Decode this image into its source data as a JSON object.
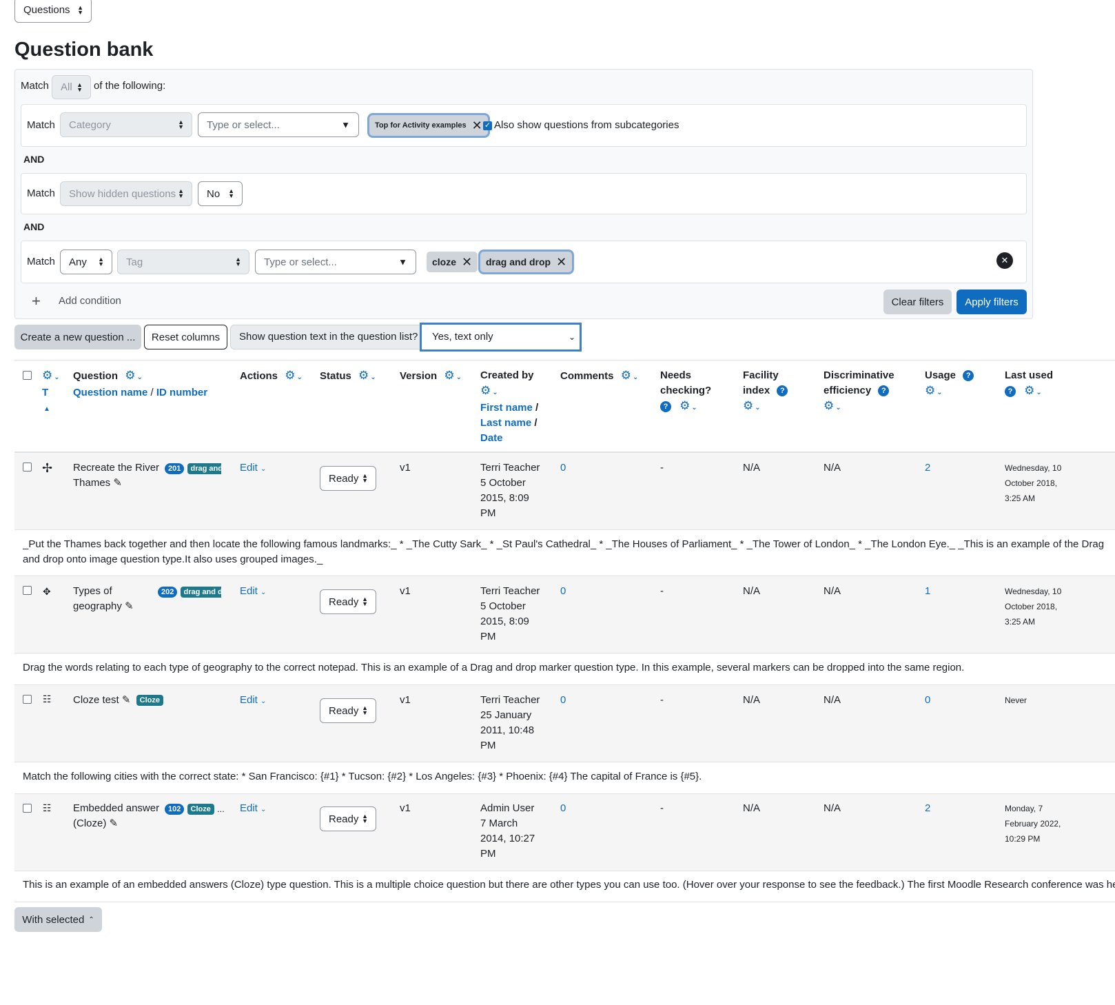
{
  "nav_select": {
    "value": "Questions"
  },
  "page_title": "Question bank",
  "filters": {
    "match_label": "Match",
    "match_all_value": "All",
    "of_following": "of the following:",
    "and_label": "AND",
    "category": {
      "match": "Match",
      "type": "Category",
      "placeholder": "Type or select...",
      "selected": "Top for Activity examples",
      "subcat_label": "Also show questions from subcategories"
    },
    "hidden": {
      "match": "Match",
      "type": "Show hidden questions",
      "value": "No"
    },
    "tag": {
      "match": "Match",
      "mode": "Any",
      "type": "Tag",
      "placeholder": "Type or select...",
      "tags": [
        "cloze",
        "drag and drop"
      ]
    },
    "add_condition": "Add condition",
    "clear": "Clear filters",
    "apply": "Apply filters"
  },
  "toolbar": {
    "create": "Create a new question ...",
    "reset": "Reset columns",
    "show_text_label": "Show question text in the question list?",
    "show_text_value": "Yes, text only"
  },
  "columns": {
    "t": "T",
    "question": "Question",
    "question_name": "Question name",
    "slash": "/",
    "id_number": "ID number",
    "actions": "Actions",
    "status": "Status",
    "version": "Version",
    "created_by": "Created by",
    "first_name": "First name",
    "last_name": "Last name",
    "date": "Date",
    "comments": "Comments",
    "needs_checking_1": "Needs",
    "needs_checking_2": "checking?",
    "facility_1": "Facility",
    "facility_2": "index",
    "discrim_1": "Discriminative",
    "discrim_2": "efficiency",
    "usage": "Usage",
    "last_used": "Last used"
  },
  "rows": [
    {
      "name_1": "Recreate the River",
      "name_2": "Thames",
      "id_badge": "201",
      "type_badge": "drag and",
      "action": "Edit",
      "status": "Ready",
      "version": "v1",
      "created_1": "Terri Teacher",
      "created_2": "5 October",
      "created_3": "2015, 8:09",
      "created_4": "PM",
      "comments": "0",
      "needs": "-",
      "facility": "N/A",
      "discrim": "N/A",
      "usage": "2",
      "last_1": "Wednesday, 10",
      "last_2": "October 2018,",
      "last_3": "3:25 AM",
      "text": "_Put the Thames back together and then locate the following famous landmarks:_ * _The Cutty Sark_ * _St Paul's Cathedral_ * _The Houses of Parliament_ * _The Tower of London_ * _The London Eye._ _This is an example of the Drag and drop onto image question type.It also uses grouped images._"
    },
    {
      "name_1": "Types of",
      "name_2": "geography",
      "id_badge": "202",
      "type_badge": "drag and dr",
      "action": "Edit",
      "status": "Ready",
      "version": "v1",
      "created_1": "Terri Teacher",
      "created_2": "5 October",
      "created_3": "2015, 8:09",
      "created_4": "PM",
      "comments": "0",
      "needs": "-",
      "facility": "N/A",
      "discrim": "N/A",
      "usage": "1",
      "last_1": "Wednesday, 10",
      "last_2": "October 2018,",
      "last_3": "3:25 AM",
      "text": "Drag the words relating to each type of geography to the correct notepad. This is an example of a Drag and drop marker question type. In this example, several markers can be dropped into the same region."
    },
    {
      "name_1": "Cloze test",
      "name_2": "",
      "id_badge": "",
      "type_badge": "Cloze",
      "action": "Edit",
      "status": "Ready",
      "version": "v1",
      "created_1": "Terri Teacher",
      "created_2": "25 January",
      "created_3": "2011, 10:48",
      "created_4": "PM",
      "comments": "0",
      "needs": "-",
      "facility": "N/A",
      "discrim": "N/A",
      "usage": "0",
      "last_1": "Never",
      "last_2": "",
      "last_3": "",
      "text": "Match the following cities with the correct state: * San Francisco: {#1} * Tucson: {#2} * Los Angeles: {#3} * Phoenix: {#4} The capital of France is {#5}."
    },
    {
      "name_1": "Embedded answer",
      "name_2": "(Cloze)",
      "id_badge": "102",
      "type_badge": "Cloze",
      "action": "Edit",
      "status": "Ready",
      "version": "v1",
      "created_1": "Admin User",
      "created_2": "7 March",
      "created_3": "2014, 10:27",
      "created_4": "PM",
      "comments": "0",
      "needs": "-",
      "facility": "N/A",
      "discrim": "N/A",
      "usage": "2",
      "last_1": "Monday, 7",
      "last_2": "February 2022,",
      "last_3": "10:29 PM",
      "text": "This is an example of an embedded answers (Cloze) type question. This is a multiple choice question but there are other types you can use too. (Hover over your response to see the feedback.)   The first Moodle Research conference was held"
    }
  ],
  "with_selected": "With selected",
  "ellipsis": "..."
}
